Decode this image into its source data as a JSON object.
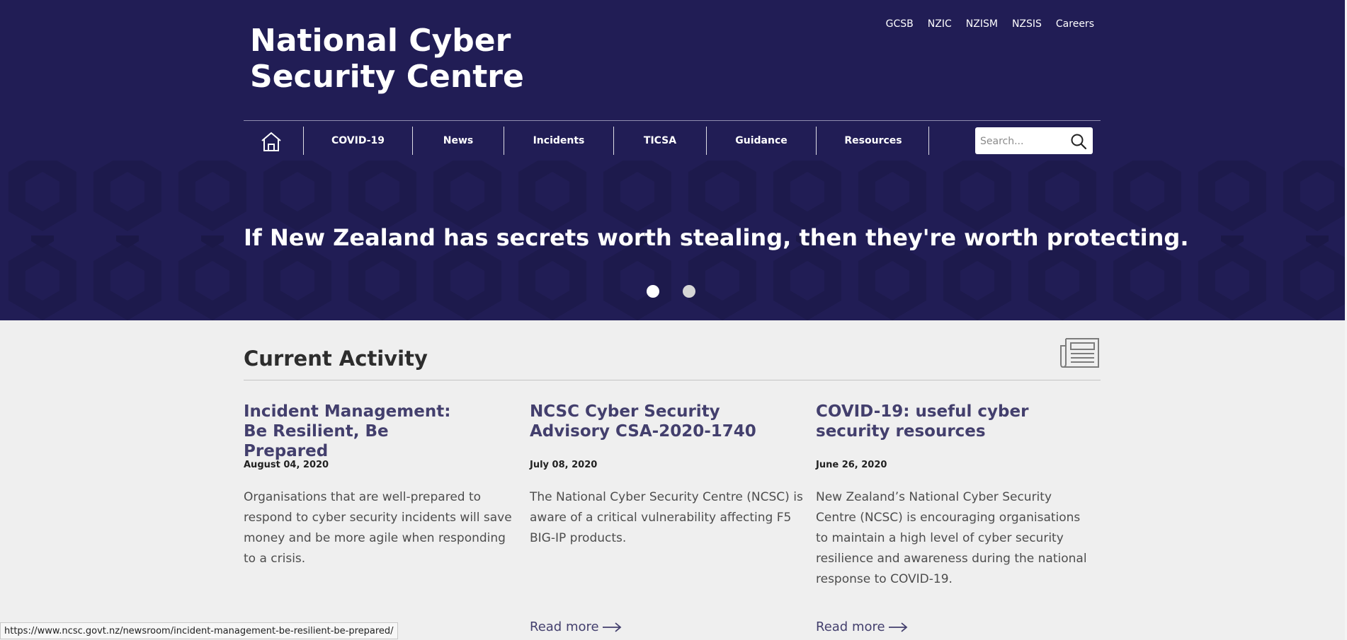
{
  "header": {
    "title_line1": "National Cyber",
    "title_line2": "Security Centre",
    "utility_links": [
      "GCSB",
      "NZIC",
      "NZISM",
      "NZSIS",
      "Careers"
    ],
    "home_icon": "home-icon",
    "nav_items": [
      "COVID-19",
      "News",
      "Incidents",
      "TICSA",
      "Guidance",
      "Resources"
    ],
    "search": {
      "placeholder": "Search...",
      "icon": "search-icon"
    }
  },
  "banner": {
    "text": "If New Zealand has secrets worth stealing, then they're worth protecting.",
    "slides": 2,
    "active_slide": 1
  },
  "activity": {
    "heading": "Current Activity",
    "icon": "newspaper-icon",
    "cards": [
      {
        "title": "Incident Management: Be Resilient, Be Prepared",
        "date": "August 04, 2020",
        "body": "Organisations that are well-prepared to respond to cyber security incidents will save money and be more agile when responding to a crisis.",
        "read_more": ""
      },
      {
        "title": "NCSC Cyber Security Advisory CSA-2020-1740",
        "date": "July 08, 2020",
        "body": "The National Cyber Security Centre (NCSC) is aware of a critical vulnerability affecting F5 BIG-IP products.",
        "read_more": "Read more"
      },
      {
        "title": "COVID-19: useful cyber security resources",
        "date": "June 26, 2020",
        "body": "New Zealand’s National Cyber Security Centre (NCSC) is encouraging organisations to maintain a high level of cyber security resilience and awareness during the national response to COVID-19.",
        "read_more": "Read more"
      }
    ]
  },
  "status_bar": {
    "url": "https://www.ncsc.govt.nz/newsroom/incident-management-be-resilient-be-prepared/"
  },
  "colors": {
    "header_bg": "#211d55",
    "title_accent": "#433f6d",
    "page_bg": "#efefef"
  }
}
